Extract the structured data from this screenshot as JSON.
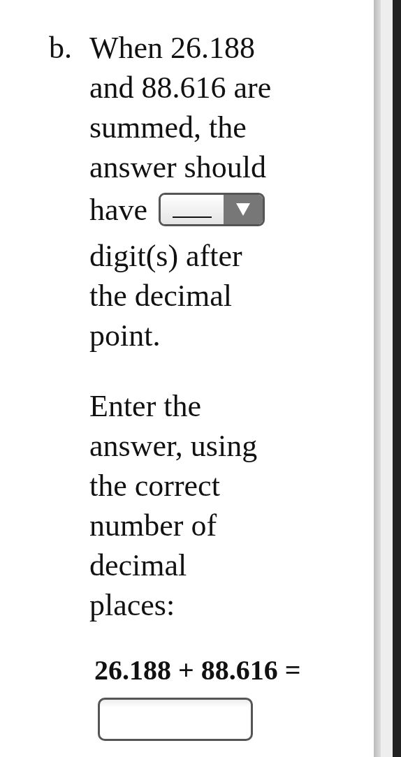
{
  "question": {
    "label": "b.",
    "text_lines": "When 26.188 and 88.616 are summed, the answer should",
    "before_dropdown": "have",
    "after_dropdown": "digit(s) after the decimal point.",
    "instruction": "Enter the answer, using the correct number of decimal places:",
    "equation": "26.188 + 88.616 ="
  }
}
